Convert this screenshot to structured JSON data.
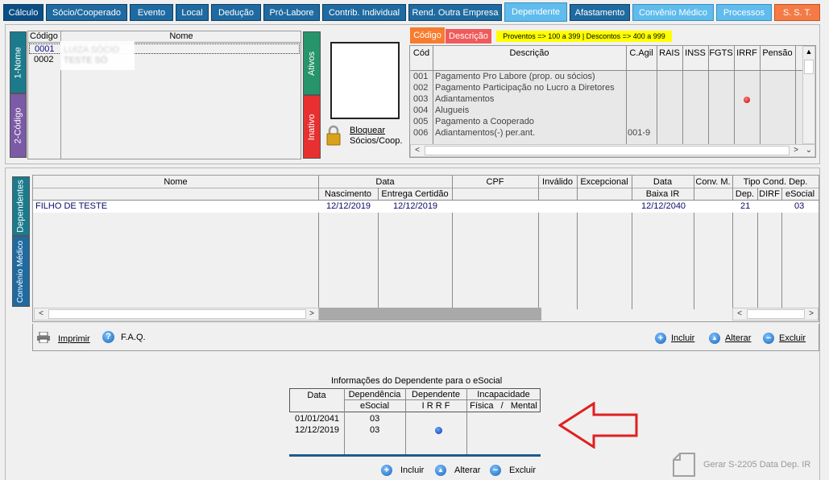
{
  "tabs": [
    {
      "label": "Cálculo"
    },
    {
      "label": "Sócio/Cooperado"
    },
    {
      "label": "Evento"
    },
    {
      "label": "Local"
    },
    {
      "label": "Dedução"
    },
    {
      "label": "Pró-Labore"
    },
    {
      "label": "Contrib. Individual"
    },
    {
      "label": "Rend. Outra Empresa"
    },
    {
      "label": "Dependente"
    },
    {
      "label": "Afastamento"
    },
    {
      "label": "Convênio Médico"
    },
    {
      "label": "Processos"
    },
    {
      "label": "S. S. T."
    }
  ],
  "socios": {
    "col_codigo": "Código",
    "col_nome": "Nome",
    "rows": [
      {
        "codigo": "0001",
        "nome": "LUIZA SÓCIO"
      },
      {
        "codigo": "0002",
        "nome": "TESTE SÓ"
      }
    ],
    "vtab_nome": "1-Nome",
    "vtab_codigo": "2-Código",
    "vtab_ativos": "Ativos",
    "vtab_inativo": "Inativo",
    "bloquear_line1": "Bloquear",
    "bloquear_line2": "Sócios/Coop."
  },
  "eventos": {
    "tab_codigo": "Código",
    "tab_descricao": "Descrição",
    "note": "Proventos => 100 a 399 | Descontos => 400 a 999",
    "headers": {
      "cod": "Cód",
      "descricao": "Descrição",
      "cagil": "C.Agil",
      "rais": "RAIS",
      "inss": "INSS",
      "fgts": "FGTS",
      "irrf": "IRRF",
      "pensao": "Pensão"
    },
    "rows": [
      {
        "cod": "001",
        "descricao": "Pagamento Pro Labore (prop. ou sócios)",
        "cagil": ""
      },
      {
        "cod": "002",
        "descricao": "Pagamento Participação no Lucro a Diretores",
        "cagil": ""
      },
      {
        "cod": "003",
        "descricao": "Adiantamentos",
        "cagil": ""
      },
      {
        "cod": "004",
        "descricao": "Alugueis",
        "cagil": ""
      },
      {
        "cod": "005",
        "descricao": "Pagamento a Cooperado",
        "cagil": ""
      },
      {
        "cod": "006",
        "descricao": "Adiantamentos(-) per.ant.",
        "cagil": "001-9"
      }
    ]
  },
  "dependentes": {
    "vtab_dependentes": "Dependentes",
    "vtab_convenio": "Convênio Médico",
    "headers": {
      "nome": "Nome",
      "data": "Data",
      "nascimento": "Nascimento",
      "entrega": "Entrega Certidão",
      "cpf": "CPF",
      "invalido": "Inválido",
      "excepcional": "Excepcional",
      "data_baixa": "Data",
      "baixa_ir": "Baixa IR",
      "conv_m": "Conv. M.",
      "tipo_cond": "Tipo Cond. Dep.",
      "dep": "Dep.",
      "dirf": "DIRF",
      "esocial": "eSocial"
    },
    "rows": [
      {
        "nome": "FILHO DE TESTE",
        "nascimento": "12/12/2019",
        "entrega": "12/12/2019",
        "cpf": "",
        "baixa": "12/12/2040",
        "dep": "21",
        "dirf": "",
        "esocial": "03"
      }
    ],
    "imprimir": "Imprimir",
    "faq": "F.A.Q.",
    "incluir": "Incluir",
    "alterar": "Alterar",
    "excluir": "Excluir"
  },
  "esocial_info": {
    "title": "Informações do Dependente para o eSocial",
    "headers": {
      "data": "Data",
      "dependencia": "Dependência",
      "dependencia_sub": "eSocial",
      "dependente": "Dependente",
      "dependente_sub": "I R R F",
      "incapacidade": "Incapacidade",
      "incapacidade_sub": "Física   /   Mental"
    },
    "rows": [
      {
        "data": "01/01/2041",
        "dependencia": "03",
        "irrf": false
      },
      {
        "data": "12/12/2019",
        "dependencia": "03",
        "irrf": true
      }
    ],
    "incluir": "Incluir",
    "alterar": "Alterar",
    "excluir": "Excluir",
    "gerar": "Gerar S-2205 Data Dep. IR"
  },
  "colors": {
    "tab_dark": "#1f6aa0",
    "tab_light": "#5fbcec",
    "tab_orange": "#f47b45",
    "vtab_teal": "#1b7b8c",
    "vtab_purple": "#7b5aa6",
    "vtab_green": "#27946b",
    "vtab_red": "#e83030",
    "tab_codigo_orange": "#f77c2e",
    "tab_descricao_red": "#f05a5a",
    "note_yellow": "#ffff00",
    "arrow_red": "#e02020"
  }
}
